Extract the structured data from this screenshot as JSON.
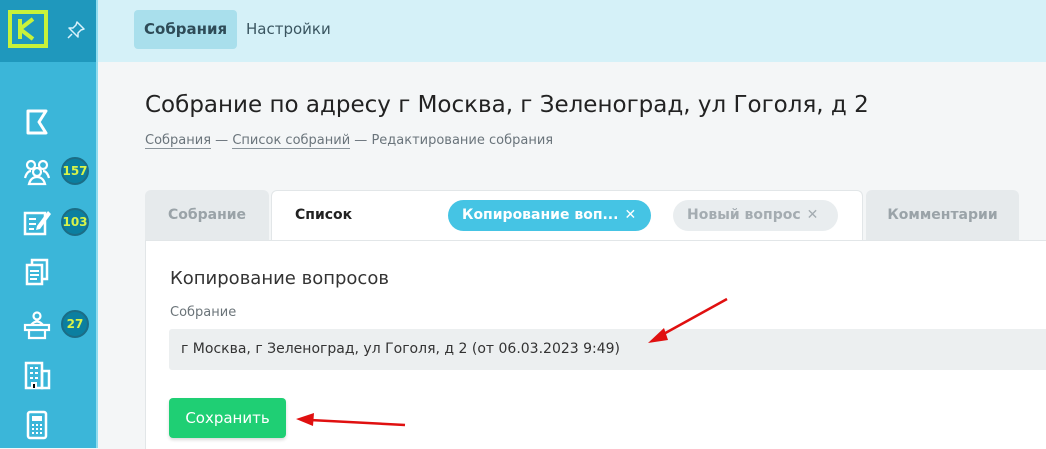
{
  "app": {
    "logo_letter": "K"
  },
  "topbar": {
    "tabs": [
      {
        "label": "Собрания",
        "active": true
      },
      {
        "label": "Настройки",
        "active": false
      }
    ]
  },
  "sidebar": {
    "items": [
      {
        "icon": "flag-icon"
      },
      {
        "icon": "people-icon",
        "badge": "157"
      },
      {
        "icon": "edit-document-icon",
        "badge": "103"
      },
      {
        "icon": "documents-icon"
      },
      {
        "icon": "meeting-podium-icon",
        "badge": "27"
      },
      {
        "icon": "building-icon"
      },
      {
        "icon": "calculator-icon"
      }
    ]
  },
  "page": {
    "title": "Собрание по адресу г Москва, г Зеленоград, ул Гоголя, д 2",
    "breadcrumb": {
      "item1": "Собрания",
      "sep1": " — ",
      "item2": "Список собраний",
      "sep2": " — ",
      "current": "Редактирование собрания"
    }
  },
  "tabs": {
    "meeting": "Собрание",
    "questions": "Список вопросов",
    "copy": "Копирование воп...",
    "new_question": "Новый вопрос",
    "comments": "Комментарии",
    "close_glyph": "✕"
  },
  "form": {
    "title": "Копирование вопросов",
    "field_label": "Собрание",
    "field_value": "г Москва, г Зеленоград, ул Гоголя, д 2 (от 06.03.2023 9:49)",
    "save_label": "Сохранить"
  },
  "colors": {
    "sidebar": "#3bb6d9",
    "accent": "#45c4e4",
    "save": "#1fcf74",
    "badge_text": "#d8f34a",
    "arrow": "#e01010"
  }
}
